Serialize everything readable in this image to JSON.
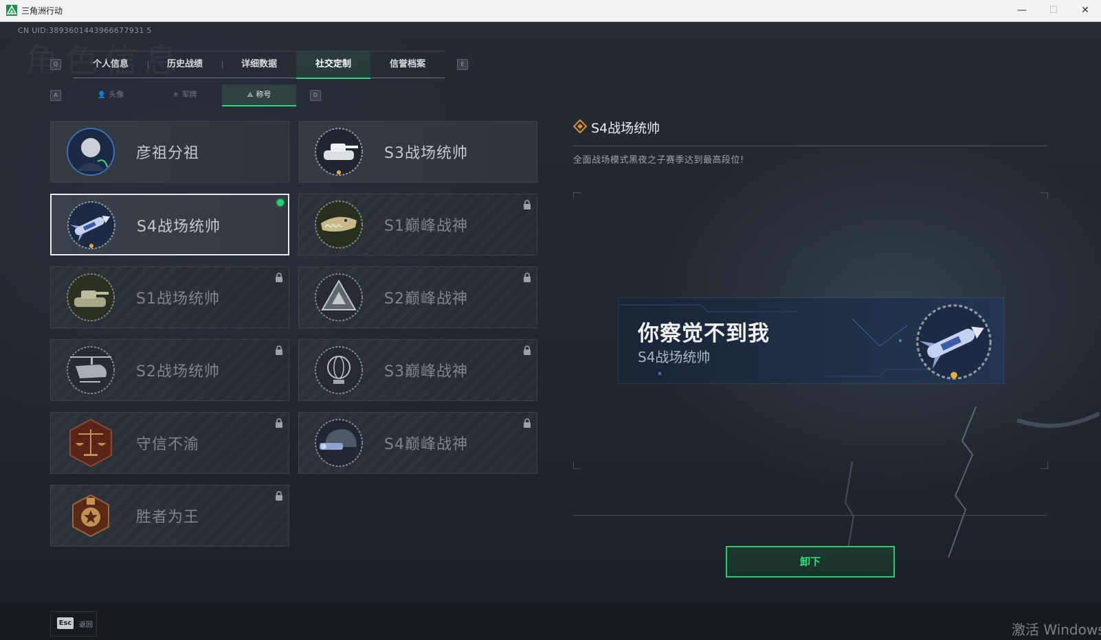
{
  "window": {
    "title": "三角洲行动",
    "minimize": "—",
    "maximize": "☐",
    "close": "✕"
  },
  "uid": "CN UID:3893601443966677931 5",
  "ghost_title": "角色信息",
  "keys": {
    "prev_tab": "Q",
    "next_tab": "E",
    "prev_sub": "A",
    "next_sub": "D"
  },
  "tabs": [
    {
      "label": "个人信息",
      "active": false
    },
    {
      "label": "历史战绩",
      "active": false
    },
    {
      "label": "详细数据",
      "active": false
    },
    {
      "label": "社交定制",
      "active": true
    },
    {
      "label": "信誉档案",
      "active": false
    }
  ],
  "subtabs": [
    {
      "label": "头像",
      "icon": "person-icon",
      "active": false
    },
    {
      "label": "军牌",
      "icon": "dogtag-icon",
      "active": false
    },
    {
      "label": "称号",
      "icon": "title-badge-icon",
      "active": true
    }
  ],
  "titles": [
    {
      "name": "彦祖分祖",
      "badge": "portrait-badge-icon",
      "locked": false,
      "equipped": false
    },
    {
      "name": "S3战场统帅",
      "badge": "tank-badge-icon",
      "locked": false,
      "equipped": false
    },
    {
      "name": "S4战场统帅",
      "badge": "missile-badge-icon",
      "locked": false,
      "equipped": true
    },
    {
      "name": "S1巅峰战神",
      "badge": "crocodile-badge-icon",
      "locked": true,
      "equipped": false
    },
    {
      "name": "S1战场统帅",
      "badge": "tank-badge-icon",
      "locked": true,
      "equipped": false
    },
    {
      "name": "S2巅峰战神",
      "badge": "triangle-badge-icon",
      "locked": true,
      "equipped": false
    },
    {
      "name": "S2战场统帅",
      "badge": "helicopter-badge-icon",
      "locked": true,
      "equipped": false
    },
    {
      "name": "S3巅峰战神",
      "badge": "globe-badge-icon",
      "locked": true,
      "equipped": false
    },
    {
      "name": "守信不渝",
      "badge": "scales-badge-icon",
      "locked": true,
      "equipped": false
    },
    {
      "name": "S4巅峰战神",
      "badge": "helmet-badge-icon",
      "locked": true,
      "equipped": false
    },
    {
      "name": "胜者为王",
      "badge": "medal-badge-icon",
      "locked": true,
      "equipped": false
    }
  ],
  "detail": {
    "title": "S4战场统帅",
    "description": "全面战场模式黑夜之子赛季达到最高段位!",
    "preview_main": "你察觉不到我",
    "preview_sub": "S4战场统帅",
    "action_button": "卸下"
  },
  "footer": {
    "esc_key": "Esc",
    "back_label": "返回"
  },
  "watermark": "激活 Windows",
  "colors": {
    "accent": "#2fd47f",
    "equipped_dot": "#27d36f",
    "background": "#1e252c"
  }
}
